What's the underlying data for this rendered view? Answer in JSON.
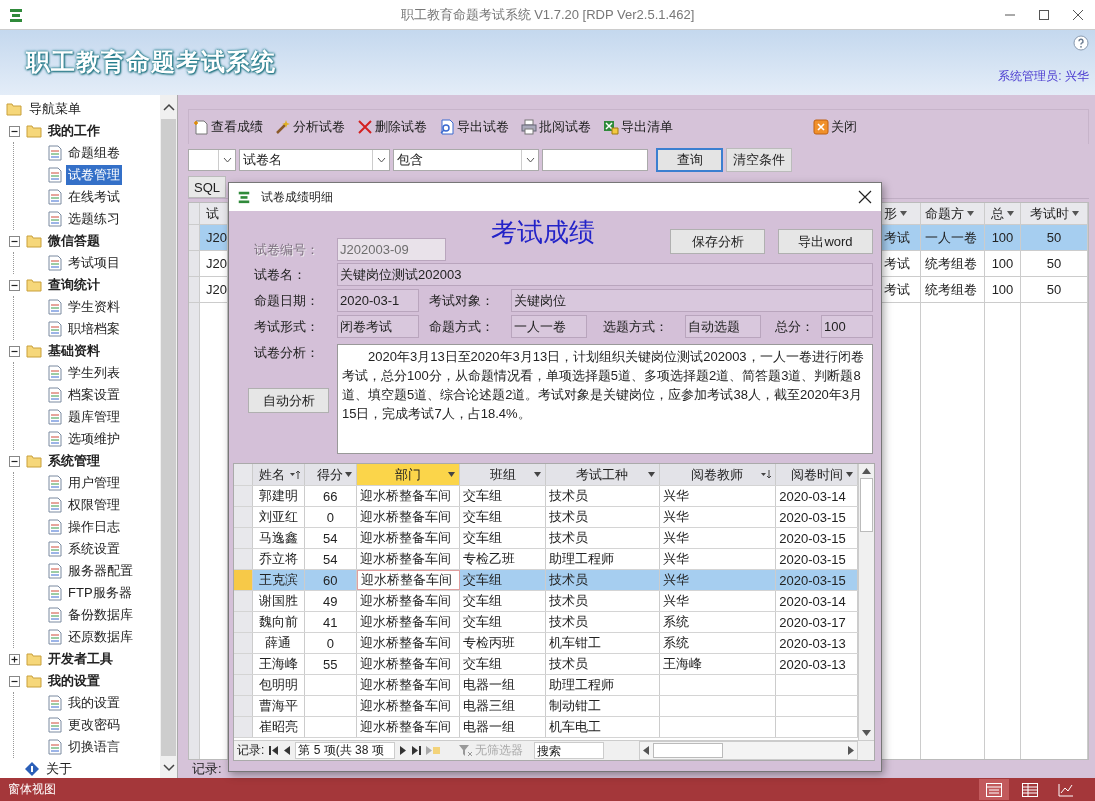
{
  "window": {
    "title": "职工教育命题考试系统 V1.7.20 [RDP Ver2.5.1.462]"
  },
  "banner": {
    "title": "职工教育命题考试系统",
    "user": "系统管理员: 兴华"
  },
  "sidebar": {
    "root": "导航菜单",
    "items": [
      {
        "label": "我的工作",
        "kind": "group",
        "expanded": true,
        "selected": false,
        "children": [
          {
            "label": "命题组卷",
            "selected": false
          },
          {
            "label": "试卷管理",
            "selected": true
          },
          {
            "label": "在线考试",
            "selected": false
          },
          {
            "label": "选题练习",
            "selected": false
          }
        ]
      },
      {
        "label": "微信答题",
        "kind": "group",
        "expanded": true,
        "selected": false,
        "children": [
          {
            "label": "考试项目",
            "selected": false
          }
        ]
      },
      {
        "label": "查询统计",
        "kind": "group",
        "expanded": true,
        "selected": false,
        "children": [
          {
            "label": "学生资料",
            "selected": false
          },
          {
            "label": "职培档案",
            "selected": false
          }
        ]
      },
      {
        "label": "基础资料",
        "kind": "group",
        "expanded": true,
        "selected": false,
        "children": [
          {
            "label": "学生列表",
            "selected": false
          },
          {
            "label": "档案设置",
            "selected": false
          },
          {
            "label": "题库管理",
            "selected": false
          },
          {
            "label": "选项维护",
            "selected": false
          }
        ]
      },
      {
        "label": "系统管理",
        "kind": "group",
        "expanded": true,
        "selected": false,
        "children": [
          {
            "label": "用户管理",
            "selected": false
          },
          {
            "label": "权限管理",
            "selected": false
          },
          {
            "label": "操作日志",
            "selected": false
          },
          {
            "label": "系统设置",
            "selected": false
          },
          {
            "label": "服务器配置",
            "selected": false
          },
          {
            "label": "FTP服务器",
            "selected": false
          },
          {
            "label": "备份数据库",
            "selected": false
          },
          {
            "label": "还原数据库",
            "selected": false
          }
        ]
      },
      {
        "label": "开发者工具",
        "kind": "group",
        "expanded": false,
        "selected": false
      },
      {
        "label": "我的设置",
        "kind": "group",
        "expanded": true,
        "selected": false,
        "children": [
          {
            "label": "我的设置",
            "selected": false
          },
          {
            "label": "更改密码",
            "selected": false
          },
          {
            "label": "切换语言",
            "selected": false
          }
        ]
      },
      {
        "label": "关于",
        "kind": "leaf",
        "selected": false
      }
    ]
  },
  "toolbar": {
    "buttons": [
      {
        "label": "查看成绩",
        "kind": "view"
      },
      {
        "label": "分析试卷",
        "kind": "analyze"
      },
      {
        "label": "删除试卷",
        "kind": "delete"
      },
      {
        "label": "导出试卷",
        "kind": "export"
      },
      {
        "label": "批阅试卷",
        "kind": "review"
      },
      {
        "label": "导出清单",
        "kind": "list"
      },
      {
        "label": "关闭",
        "kind": "close"
      }
    ]
  },
  "filter": {
    "field": "试卷名",
    "operator": "包含",
    "query_button": "查询",
    "clear_button": "清空条件"
  },
  "sql_tab": "SQL",
  "grid": {
    "columns": [
      "试",
      "形",
      "命题方",
      "总",
      "考试时"
    ],
    "rows": [
      {
        "selected": true,
        "cells": [
          "J20",
          "考试",
          "一人一卷",
          "100",
          "50"
        ]
      },
      {
        "selected": false,
        "cells": [
          "J20",
          "考试",
          "统考组卷",
          "100",
          "50"
        ]
      },
      {
        "selected": false,
        "cells": [
          "J20",
          "考试",
          "统考组卷",
          "100",
          "50"
        ]
      }
    ],
    "record_label": "记录:"
  },
  "dialog": {
    "title": "试卷成绩明细",
    "heading": "考试成绩",
    "buttons": [
      "保存分析",
      "导出word"
    ],
    "paper_no": {
      "label": "试卷编号：",
      "value": "J202003-09",
      "disabled": true
    },
    "paper_name": {
      "label": "试卷名：",
      "value": "关键岗位测试202003"
    },
    "date": {
      "label": "命题日期：",
      "value": "2020-03-1"
    },
    "target": {
      "label": "考试对象：",
      "value": "关键岗位"
    },
    "form": {
      "label": "考试形式：",
      "value": "闭卷考试"
    },
    "method": {
      "label": "命题方式：",
      "value": "一人一卷"
    },
    "selection": {
      "label": "选题方式：",
      "value": "自动选题"
    },
    "total": {
      "label": "总分：",
      "value": "100"
    },
    "analysis": {
      "label": "试卷分析：",
      "value": "2020年3月13日至2020年3月13日，计划组织关键岗位测试202003，一人一卷进行闭卷考试，总分100分，从命题情况看，单项选择题5道、多项选择题2道、简答题3道、判断题8道、填空题5道、综合论述题2道。考试对象是关键岗位，应参加考试38人，截至2020年3月15日，完成考试7人，占18.4%。"
    },
    "auto_button": "自动分析",
    "table": {
      "columns": [
        {
          "label": "姓名",
          "kind": "ascending",
          "selected": false
        },
        {
          "label": "得分",
          "kind": "plain",
          "selected": false
        },
        {
          "label": "部门",
          "kind": "plain",
          "selected": true
        },
        {
          "label": "班组",
          "kind": "plain",
          "selected": false
        },
        {
          "label": "考试工种",
          "kind": "plain",
          "selected": false
        },
        {
          "label": "阅卷教师",
          "kind": "descending",
          "selected": false
        },
        {
          "label": "阅卷时间",
          "kind": "plain",
          "selected": false
        }
      ],
      "rows": [
        {
          "selected": false,
          "cells": [
            "郭建明",
            "66",
            "迎水桥整备车间",
            "交车组",
            "技术员",
            "兴华",
            "2020-03-14"
          ]
        },
        {
          "selected": false,
          "cells": [
            "刘亚红",
            "0",
            "迎水桥整备车间",
            "交车组",
            "技术员",
            "兴华",
            "2020-03-15"
          ]
        },
        {
          "selected": false,
          "cells": [
            "马逸鑫",
            "54",
            "迎水桥整备车间",
            "交车组",
            "技术员",
            "兴华",
            "2020-03-15"
          ]
        },
        {
          "selected": false,
          "cells": [
            "乔立将",
            "54",
            "迎水桥整备车间",
            "专检乙班",
            "助理工程师",
            "兴华",
            "2020-03-15"
          ]
        },
        {
          "selected": true,
          "cells": [
            "王克滨",
            "60",
            "迎水桥整备车间",
            "交车组",
            "技术员",
            "兴华",
            "2020-03-15"
          ]
        },
        {
          "selected": false,
          "cells": [
            "谢国胜",
            "49",
            "迎水桥整备车间",
            "交车组",
            "技术员",
            "兴华",
            "2020-03-14"
          ]
        },
        {
          "selected": false,
          "cells": [
            "魏向前",
            "41",
            "迎水桥整备车间",
            "交车组",
            "技术员",
            "系统",
            "2020-03-17"
          ]
        },
        {
          "selected": false,
          "cells": [
            "薛通",
            "0",
            "迎水桥整备车间",
            "专检丙班",
            "机车钳工",
            "系统",
            "2020-03-13"
          ]
        },
        {
          "selected": false,
          "cells": [
            "王海峰",
            "55",
            "迎水桥整备车间",
            "交车组",
            "技术员",
            "王海峰",
            "2020-03-13"
          ]
        },
        {
          "selected": false,
          "cells": [
            "包明明",
            "",
            "迎水桥整备车间",
            "电器一组",
            "助理工程师",
            "",
            ""
          ]
        },
        {
          "selected": false,
          "cells": [
            "曹海平",
            "",
            "迎水桥整备车间",
            "电器三组",
            "制动钳工",
            "",
            ""
          ]
        },
        {
          "selected": false,
          "cells": [
            "崔昭亮",
            "",
            "迎水桥整备车间",
            "电器一组",
            "机车电工",
            "",
            ""
          ]
        }
      ]
    },
    "nav": {
      "label": "记录:",
      "position": "第 5 项(共 38 项",
      "filter": {
        "label": "无筛选器",
        "disabled": true
      },
      "search": {
        "placeholder": "搜索"
      }
    }
  },
  "status_bar": {
    "view": "窗体视图",
    "views": [
      {
        "selected": true
      },
      {
        "selected": false
      },
      {
        "selected": false
      }
    ]
  }
}
